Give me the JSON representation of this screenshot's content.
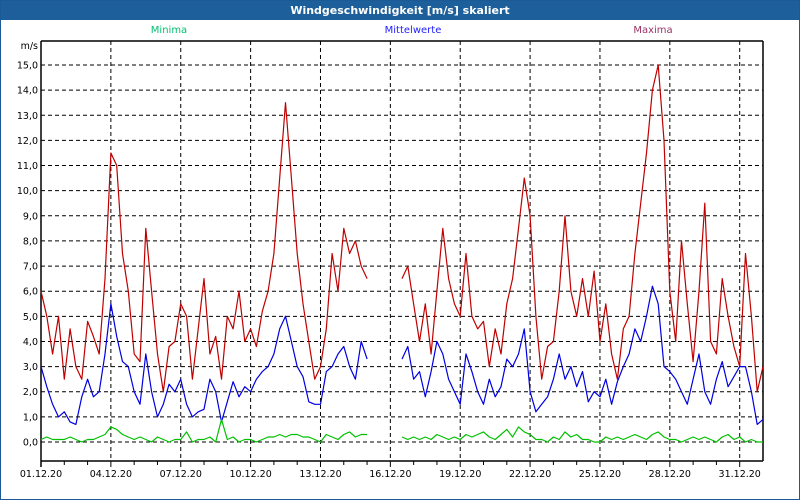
{
  "window": {
    "title": "Windgeschwindigkeit [m/s] skaliert"
  },
  "chart_data": {
    "type": "line",
    "title": "Windgeschwindigkeit [m/s] skaliert",
    "ylabel": "m/s",
    "ylim": [
      -0.75,
      16.0
    ],
    "yticks": [
      0,
      1,
      2,
      3,
      4,
      5,
      6,
      7,
      8,
      9,
      10,
      11,
      12,
      13,
      14,
      15
    ],
    "ytick_labels": [
      "0,0",
      "1,0",
      "2,0",
      "3,0",
      "4,0",
      "5,0",
      "6,0",
      "7,0",
      "8,0",
      "9,0",
      "10,0",
      "11,0",
      "12,0",
      "13,0",
      "14,0",
      "15,0"
    ],
    "x_unit": "days since 01.12.20",
    "xlim": [
      0,
      31.0
    ],
    "xticks": [
      0,
      3,
      6,
      9,
      12,
      15,
      18,
      21,
      24,
      27,
      30
    ],
    "xtick_labels": [
      "01.12.20",
      "04.12.20",
      "07.12.20",
      "10.12.20",
      "13.12.20",
      "16.12.20",
      "19.12.20",
      "22.12.20",
      "25.12.20",
      "28.12.20",
      "31.12.20"
    ],
    "grid": true,
    "legend_position": "top",
    "series": [
      {
        "name": "Minima",
        "color": "#00c000",
        "segments": [
          {
            "x_start": 0,
            "step": 0.25,
            "values": [
              0.1,
              0.2,
              0.1,
              0.1,
              0.1,
              0.2,
              0.1,
              0.0,
              0.1,
              0.1,
              0.2,
              0.3,
              0.6,
              0.5,
              0.3,
              0.2,
              0.1,
              0.2,
              0.1,
              0.0,
              0.2,
              0.1,
              0.0,
              0.1,
              0.1,
              0.4,
              0.0,
              0.1,
              0.1,
              0.2,
              0.0,
              0.9,
              0.1,
              0.2,
              0.0,
              0.1,
              0.1,
              0.0,
              0.1,
              0.2,
              0.2,
              0.3,
              0.2,
              0.3,
              0.3,
              0.2,
              0.2,
              0.1,
              0.0,
              0.3,
              0.2,
              0.1,
              0.3,
              0.4,
              0.2,
              0.3,
              0.3
            ]
          },
          {
            "x_start": 15.5,
            "step": 0.25,
            "values": [
              0.2,
              0.1,
              0.2,
              0.1,
              0.2,
              0.1,
              0.3,
              0.2,
              0.1,
              0.2,
              0.1,
              0.3,
              0.2,
              0.3,
              0.4,
              0.2,
              0.1,
              0.3,
              0.5,
              0.2,
              0.6,
              0.4,
              0.3,
              0.1,
              0.1,
              0.0,
              0.2,
              0.1,
              0.4,
              0.2,
              0.3,
              0.1,
              0.1,
              0.0,
              0.0,
              0.2,
              0.1,
              0.2,
              0.1,
              0.2,
              0.3,
              0.2,
              0.1,
              0.3,
              0.4,
              0.2,
              0.1,
              0.1,
              0.0,
              0.1,
              0.2,
              0.1,
              0.2,
              0.1,
              0.0,
              0.2,
              0.3,
              0.1,
              0.2,
              0.0,
              0.1,
              0.0,
              0.0
            ]
          }
        ]
      },
      {
        "name": "Mittelwerte",
        "color": "#0000e0",
        "segments": [
          {
            "x_start": 0,
            "step": 0.25,
            "values": [
              3.0,
              2.2,
              1.5,
              1.0,
              1.2,
              0.8,
              0.7,
              1.8,
              2.5,
              1.8,
              2.0,
              3.5,
              5.5,
              4.2,
              3.2,
              3.0,
              2.0,
              1.5,
              3.5,
              2.0,
              1.0,
              1.5,
              2.3,
              2.0,
              2.5,
              1.5,
              1.0,
              1.2,
              1.3,
              2.5,
              2.0,
              0.8,
              1.6,
              2.4,
              1.8,
              2.2,
              2.0,
              2.5,
              2.8,
              3.0,
              3.5,
              4.5,
              5.0,
              4.0,
              3.0,
              2.6,
              1.6,
              1.5,
              1.5,
              2.8,
              3.0,
              3.5,
              3.8,
              3.0,
              2.5,
              4.0,
              3.3
            ]
          },
          {
            "x_start": 15.5,
            "step": 0.25,
            "values": [
              3.3,
              3.8,
              2.5,
              2.8,
              1.8,
              2.8,
              4.0,
              3.5,
              2.5,
              2.0,
              1.5,
              3.5,
              2.8,
              2.0,
              1.5,
              2.5,
              1.8,
              2.2,
              3.3,
              3.0,
              3.5,
              4.5,
              2.0,
              1.2,
              1.5,
              1.8,
              2.5,
              3.5,
              2.5,
              3.0,
              2.2,
              2.8,
              1.6,
              2.0,
              1.8,
              2.5,
              1.5,
              2.4,
              3.0,
              3.5,
              4.5,
              4.0,
              5.0,
              6.2,
              5.5,
              3.0,
              2.8,
              2.5,
              2.0,
              1.5,
              2.5,
              3.5,
              2.0,
              1.5,
              2.5,
              3.2,
              2.2,
              2.6,
              3.0,
              3.0,
              2.0,
              0.7,
              0.9
            ]
          }
        ]
      },
      {
        "name": "Maxima",
        "color": "#c00000",
        "segments": [
          {
            "x_start": 0,
            "step": 0.25,
            "values": [
              6.0,
              5.0,
              3.5,
              5.0,
              2.5,
              4.5,
              3.0,
              2.5,
              4.8,
              4.2,
              3.5,
              6.5,
              11.5,
              11.0,
              7.5,
              6.0,
              3.5,
              3.2,
              8.5,
              6.0,
              3.5,
              2.0,
              3.8,
              4.0,
              5.5,
              5.0,
              2.5,
              4.5,
              6.5,
              3.5,
              4.2,
              2.5,
              5.0,
              4.5,
              6.0,
              4.0,
              4.5,
              3.8,
              5.2,
              6.0,
              7.5,
              10.5,
              13.5,
              10.5,
              7.5,
              5.5,
              4.0,
              2.5,
              3.0,
              4.5,
              7.5,
              6.0,
              8.5,
              7.5,
              8.0,
              7.0,
              6.5
            ]
          },
          {
            "x_start": 15.5,
            "step": 0.25,
            "values": [
              6.5,
              7.0,
              5.5,
              4.0,
              5.5,
              3.5,
              6.0,
              8.5,
              6.5,
              5.5,
              5.0,
              7.5,
              5.0,
              4.5,
              4.8,
              3.0,
              4.5,
              3.5,
              5.5,
              6.5,
              8.5,
              10.5,
              9.0,
              5.0,
              2.5,
              3.8,
              4.0,
              6.0,
              9.0,
              6.0,
              5.0,
              6.5,
              5.0,
              6.8,
              4.0,
              5.5,
              3.5,
              2.5,
              4.5,
              5.0,
              7.5,
              9.5,
              11.5,
              14.0,
              15.0,
              12.0,
              6.0,
              4.0,
              8.0,
              5.5,
              3.2,
              6.0,
              9.5,
              4.0,
              3.5,
              6.5,
              5.0,
              3.8,
              3.0,
              7.5,
              5.0,
              2.0,
              3.0
            ]
          }
        ]
      }
    ]
  },
  "legend_colors": {
    "Minima": "#00c070",
    "Mittelwerte": "#2020ff",
    "Maxima": "#993366"
  }
}
